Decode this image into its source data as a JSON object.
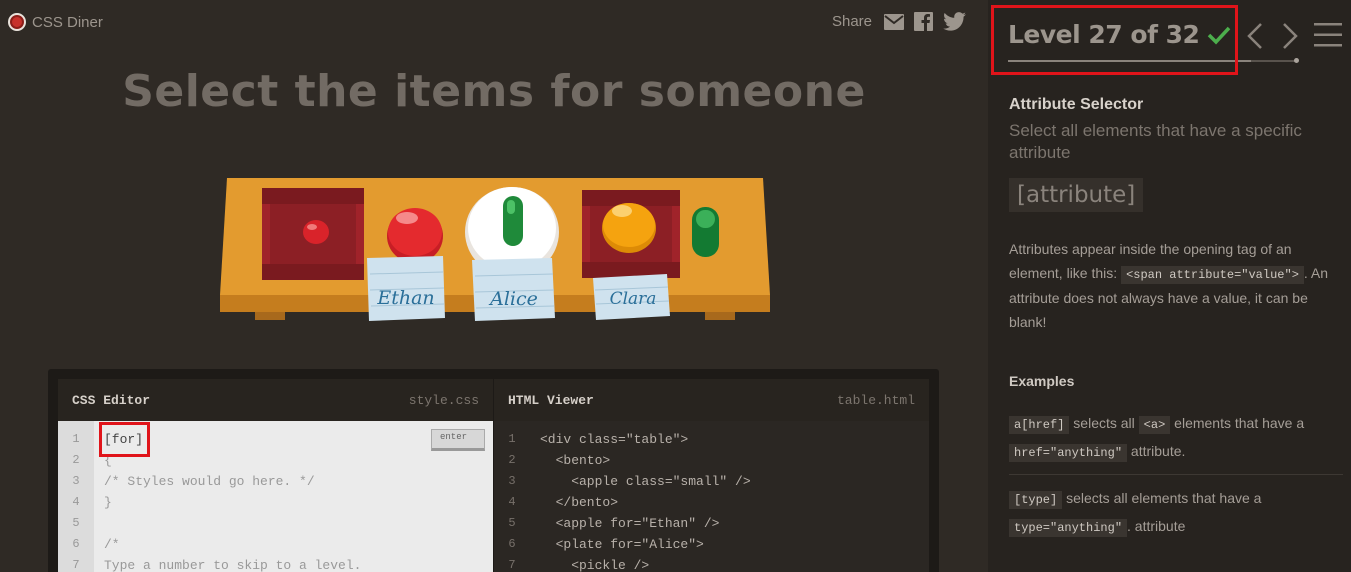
{
  "app": {
    "name": "CSS Diner"
  },
  "share": {
    "label": "Share"
  },
  "instruction": "Select the items for someone",
  "table": {
    "name_cards": [
      "Ethan",
      "Alice",
      "Clara"
    ]
  },
  "css_editor": {
    "title": "CSS Editor",
    "file": "style.css",
    "line_numbers": [
      "1",
      "2",
      "3",
      "4",
      "5",
      "6",
      "7"
    ],
    "input_value": "[for]",
    "lines": [
      "{",
      "/* Styles would go here. */",
      "}",
      "",
      "/*",
      "Type a number to skip to a level."
    ],
    "enter_label": "enter"
  },
  "html_viewer": {
    "title": "HTML Viewer",
    "file": "table.html",
    "line_numbers": [
      "1",
      "2",
      "3",
      "4",
      "5",
      "6",
      "7"
    ],
    "lines": [
      "<div class=\"table\">",
      "  <bento>",
      "    <apple class=\"small\" />",
      "  </bento>",
      "  <apple for=\"Ethan\" />",
      "  <plate for=\"Alice\">",
      "    <pickle />"
    ]
  },
  "level": {
    "label": "Level 27 of 32",
    "current": 27,
    "total": 32,
    "completed": true
  },
  "sidebar": {
    "title": "Attribute Selector",
    "subtitle": "Select all elements that have a specific attribute",
    "syntax": "[attribute]",
    "desc_1": "Attributes appear inside the opening tag of an element, like this: ",
    "desc_tag": "<span attribute=\"value\">",
    "desc_2": ". An attribute does not always have a value, it can be blank!",
    "examples_title": "Examples",
    "ex1_code1": "a[href]",
    "ex1_text1": " selects all ",
    "ex1_code2": "<a>",
    "ex1_text2": " elements that have a ",
    "ex1_code3": "href=\"anything\"",
    "ex1_text3": " attribute.",
    "ex2_code1": "[type]",
    "ex2_text1": " selects all elements that have a ",
    "ex2_code2": "type=\"anything\"",
    "ex2_text2": ". attribute"
  },
  "colors": {
    "accent_check": "#4cae4c",
    "highlight": "#e0141a",
    "table_wood": "#e39b2f"
  }
}
